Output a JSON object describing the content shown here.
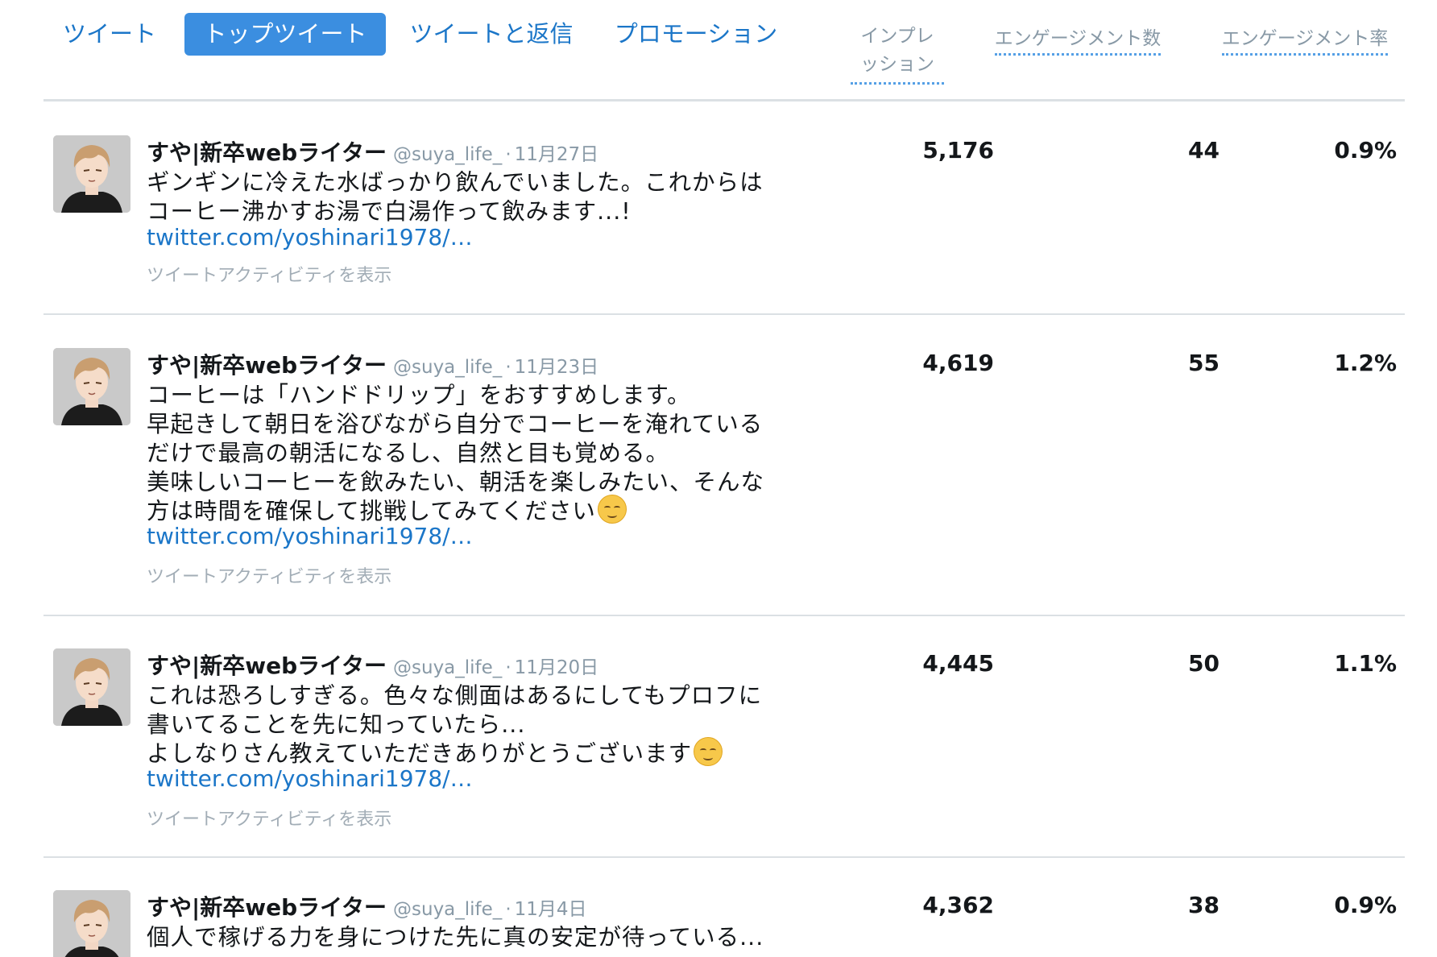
{
  "tabs": [
    {
      "label": "ツイート",
      "active": false
    },
    {
      "label": "トップツイート",
      "active": true
    },
    {
      "label": "ツイートと返信",
      "active": false
    },
    {
      "label": "プロモーション",
      "active": false
    }
  ],
  "columns": {
    "impressions_line1": "インプレ",
    "impressions_line2": "ッション",
    "engagements": "エンゲージメント数",
    "engagement_rate": "エンゲージメント率"
  },
  "colors": {
    "accent": "#1b76c8",
    "active_tab_bg": "#3b8ee0",
    "muted": "#8899a6"
  },
  "tweets": [
    {
      "name": "すや|新卒webライター",
      "handle": "@suya_life_",
      "sep": "·",
      "date": "11月27日",
      "lines": [
        "ギンギンに冷えた水ばっかり飲んでいました。これからは",
        "コーヒー沸かすお湯で白湯作って飲みます...!"
      ],
      "link": "twitter.com/yoshinari1978/…",
      "activity": "ツイートアクティビティを表示",
      "impressions": "5,176",
      "engagements": "44",
      "rate": "0.9%"
    },
    {
      "name": "すや|新卒webライター",
      "handle": "@suya_life_",
      "sep": "·",
      "date": "11月23日",
      "lines": [
        "コーヒーは「ハンドドリップ」をおすすめします。",
        "早起きして朝日を浴びながら自分でコーヒーを淹れている",
        "だけで最高の朝活になるし、自然と目も覚める。",
        "美味しいコーヒーを飲みたい、朝活を楽しみたい、そんな",
        "方は時間を確保して挑戦してみてください"
      ],
      "link": "twitter.com/yoshinari1978/…",
      "activity": "ツイートアクティビティを表示",
      "impressions": "4,619",
      "engagements": "55",
      "rate": "1.2%"
    },
    {
      "name": "すや|新卒webライター",
      "handle": "@suya_life_",
      "sep": "·",
      "date": "11月20日",
      "lines": [
        "これは恐ろしすぎる。色々な側面はあるにしてもプロフに",
        "書いてることを先に知っていたら...",
        "よしなりさん教えていただきありがとうございます"
      ],
      "link": "twitter.com/yoshinari1978/…",
      "activity": "ツイートアクティビティを表示",
      "impressions": "4,445",
      "engagements": "50",
      "rate": "1.1%"
    },
    {
      "name": "すや|新卒webライター",
      "handle": "@suya_life_",
      "sep": "·",
      "date": "11月4日",
      "lines": [
        "個人で稼げる力を身につけた先に真の安定が待っている..."
      ],
      "impressions": "4,362",
      "engagements": "38",
      "rate": "0.9%"
    }
  ]
}
